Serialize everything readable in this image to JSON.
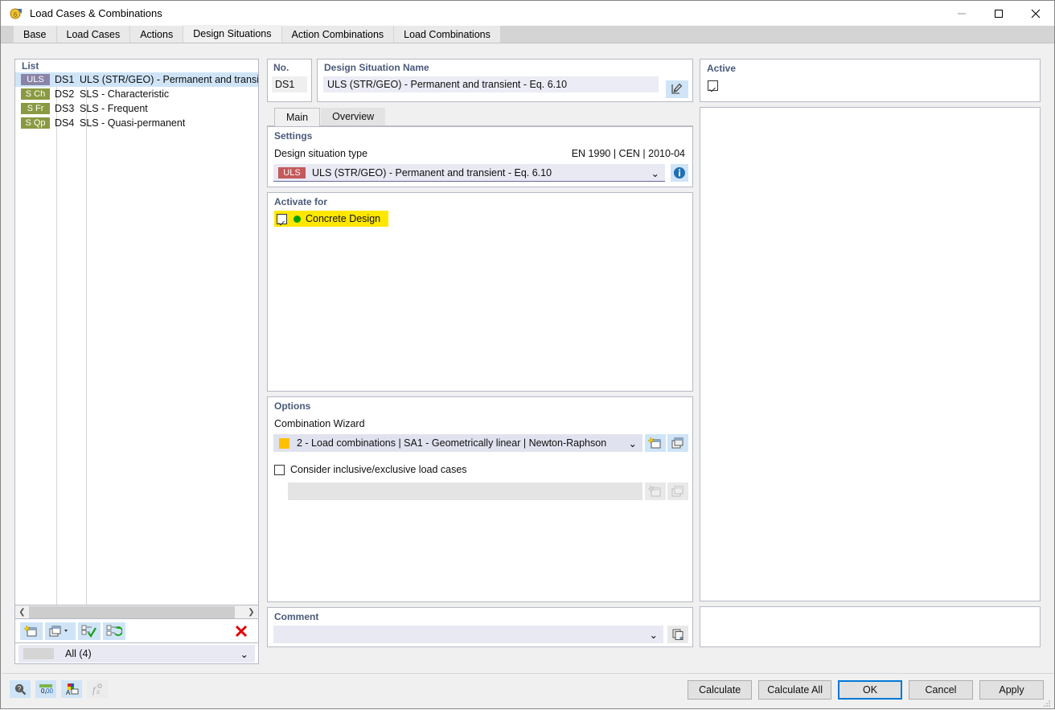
{
  "window": {
    "title": "Load Cases & Combinations",
    "icon": "app-icon",
    "minimize": "–",
    "maximize": "□",
    "close": "✕"
  },
  "tabs": [
    {
      "label": "Base",
      "active": false
    },
    {
      "label": "Load Cases",
      "active": false
    },
    {
      "label": "Actions",
      "active": false
    },
    {
      "label": "Design Situations",
      "active": true
    },
    {
      "label": "Action Combinations",
      "active": false
    },
    {
      "label": "Load Combinations",
      "active": false
    }
  ],
  "list": {
    "header": "List",
    "rows": [
      {
        "badge": "ULS",
        "badge_type": "uls",
        "no": "DS1",
        "name": "ULS (STR/GEO) - Permanent and transient - E",
        "selected": true
      },
      {
        "badge": "S Ch",
        "badge_type": "sls",
        "no": "DS2",
        "name": "SLS - Characteristic",
        "selected": false
      },
      {
        "badge": "S Fr",
        "badge_type": "sls",
        "no": "DS3",
        "name": "SLS - Frequent",
        "selected": false
      },
      {
        "badge": "S Qp",
        "badge_type": "sls",
        "no": "DS4",
        "name": "SLS - Quasi-permanent",
        "selected": false
      }
    ],
    "scroll_left": "❮",
    "scroll_right": "❯",
    "toolbar": {
      "new": "new-item-icon",
      "copy": "copy-item-icon",
      "copy_caret": "▾",
      "select_all": "select-all-icon",
      "invert": "invert-selection-icon",
      "delete": "✕"
    },
    "filter": "All (4)",
    "filter_caret": "⌄"
  },
  "identity": {
    "no_header": "No.",
    "no_value": "DS1",
    "name_header": "Design Situation Name",
    "name_value": "ULS (STR/GEO) - Permanent and transient - Eq. 6.10",
    "edit_icon": "edit-pencil-icon"
  },
  "subtabs": [
    {
      "label": "Main",
      "active": true
    },
    {
      "label": "Overview",
      "active": false
    }
  ],
  "settings": {
    "title": "Settings",
    "type_label": "Design situation type",
    "standard": "EN 1990 | CEN | 2010-04",
    "type_badge": "ULS",
    "type_value": "ULS (STR/GEO) - Permanent and transient - Eq. 6.10",
    "caret": "⌄",
    "info_icon": "info-icon"
  },
  "activate": {
    "title": "Activate for",
    "items": [
      {
        "label": "Concrete Design",
        "checked": true,
        "dot_color": "#00a000",
        "highlight": "#ffe700"
      }
    ]
  },
  "options": {
    "title": "Options",
    "wizard_label": "Combination Wizard",
    "wizard_value": "2 - Load combinations | SA1 - Geometrically linear | Newton-Raphson",
    "wizard_swatch": "#ffc000",
    "caret": "⌄",
    "new_icon": "new-wizard-icon",
    "edit_icon": "edit-wizard-icon",
    "inclusive_label": "Consider inclusive/exclusive load cases",
    "inclusive_checked": false,
    "inclusive_new_icon": "new-disabled-icon",
    "inclusive_edit_icon": "edit-disabled-icon"
  },
  "comment": {
    "title": "Comment",
    "value": "",
    "caret": "⌄",
    "copy_icon": "copy-comment-icon"
  },
  "active_panel": {
    "title": "Active",
    "checked": true
  },
  "statusbar": {
    "icons": [
      {
        "name": "help-magnifier-icon",
        "enabled": true
      },
      {
        "name": "number-format-icon",
        "enabled": true
      },
      {
        "name": "display-properties-icon",
        "enabled": true
      },
      {
        "name": "formula-icon",
        "enabled": false
      }
    ]
  },
  "buttons": [
    {
      "label": "Calculate",
      "primary": false
    },
    {
      "label": "Calculate All",
      "primary": false
    },
    {
      "label": "OK",
      "primary": true
    },
    {
      "label": "Cancel",
      "primary": false
    },
    {
      "label": "Apply",
      "primary": false
    }
  ],
  "colors": {
    "accent_blue": "#0078d7",
    "highlight_yellow": "#ffe700",
    "uls_badge": "#8a84a8",
    "uls_red": "#c45a5a",
    "sls_badge": "#8a9a42",
    "selection": "#cfe4f7",
    "header_text": "#4a5a7a"
  }
}
